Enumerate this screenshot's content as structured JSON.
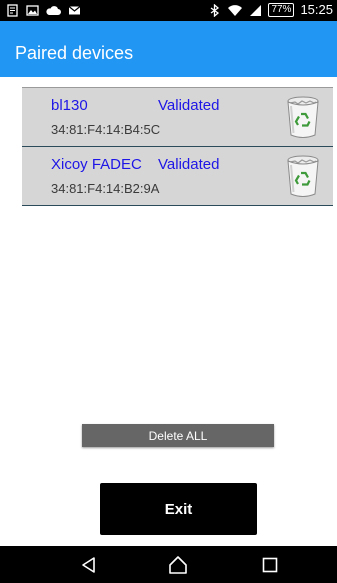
{
  "status_bar": {
    "time": "15:25",
    "battery": "77%",
    "left_icons": [
      "notes-icon",
      "image-icon",
      "cloud-icon",
      "mail-icon"
    ],
    "right_icons": [
      "bluetooth-icon",
      "wifi-icon",
      "signal-icon"
    ]
  },
  "app_bar": {
    "title": "Paired devices",
    "color": "#2196f3"
  },
  "devices": [
    {
      "name": "bl130",
      "status": "Validated",
      "address": "34:81:F4:14:B4:5C"
    },
    {
      "name": "Xicoy FADEC",
      "status": "Validated",
      "address": "34:81:F4:14:B2:9A"
    }
  ],
  "actions": {
    "delete_all": "Delete ALL",
    "exit": "Exit"
  },
  "colors": {
    "device_text": "#1e16e6",
    "row_background": "#d6d6d6"
  },
  "nav_bar": {
    "buttons": [
      "back-icon",
      "home-icon",
      "recent-apps-icon"
    ]
  }
}
